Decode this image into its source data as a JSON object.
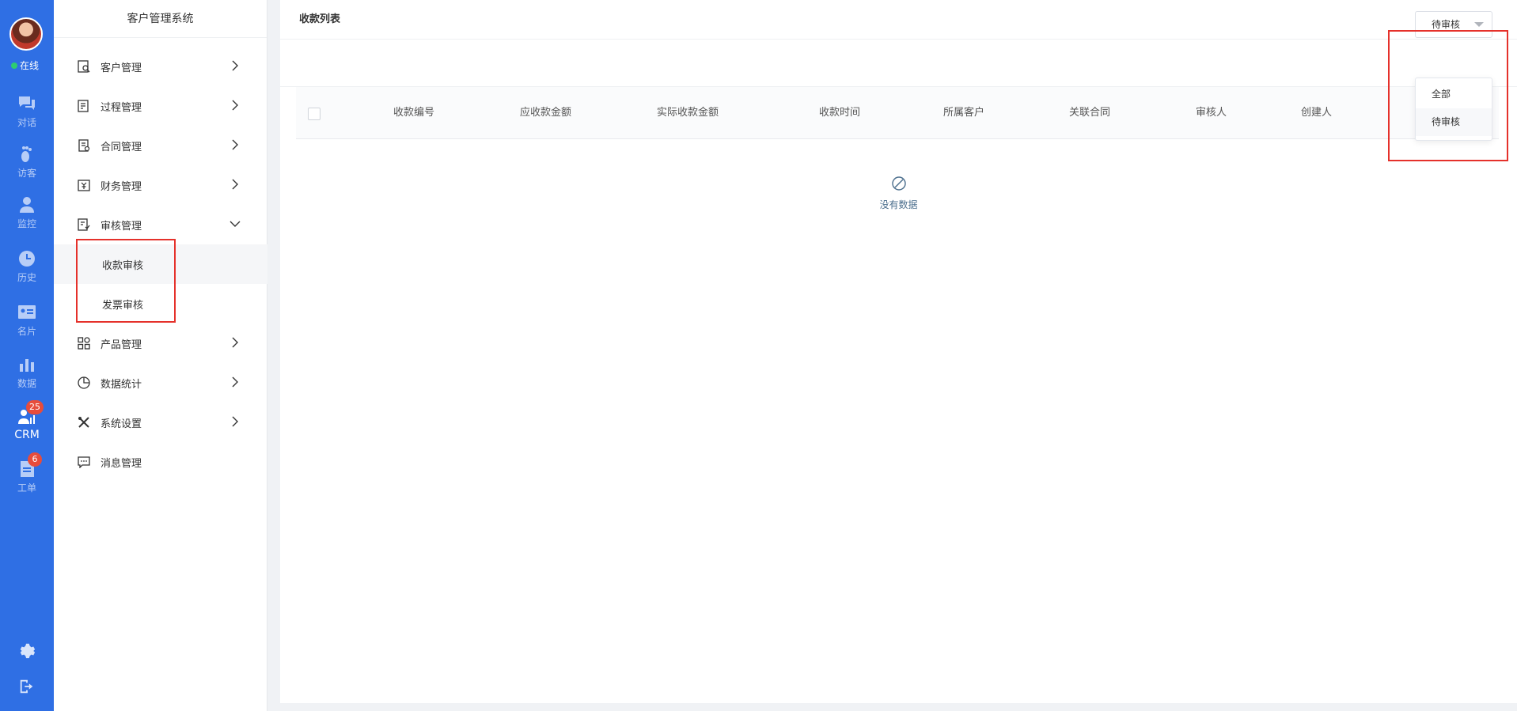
{
  "rail": {
    "status": "在线",
    "items": [
      {
        "label": "对话",
        "icon": "chat-icon"
      },
      {
        "label": "访客",
        "icon": "footprint-icon"
      },
      {
        "label": "监控",
        "icon": "monitor-icon"
      },
      {
        "label": "历史",
        "icon": "clock-icon"
      },
      {
        "label": "名片",
        "icon": "card-icon"
      },
      {
        "label": "数据",
        "icon": "bar-chart-icon"
      },
      {
        "label": "CRM",
        "icon": "crm-icon",
        "badge": "25"
      },
      {
        "label": "工单",
        "icon": "ticket-icon",
        "badge": "6"
      }
    ]
  },
  "sidebar": {
    "title": "客户管理系统",
    "items": [
      {
        "label": "客户管理",
        "icon": "customer-icon"
      },
      {
        "label": "过程管理",
        "icon": "process-icon"
      },
      {
        "label": "合同管理",
        "icon": "contract-icon"
      },
      {
        "label": "财务管理",
        "icon": "finance-icon"
      },
      {
        "label": "审核管理",
        "icon": "audit-icon"
      },
      {
        "label": "产品管理",
        "icon": "product-icon"
      },
      {
        "label": "数据统计",
        "icon": "pie-chart-icon"
      },
      {
        "label": "系统设置",
        "icon": "tools-icon"
      },
      {
        "label": "消息管理",
        "icon": "message-icon"
      }
    ],
    "sub_items": [
      {
        "label": "收款审核"
      },
      {
        "label": "发票审核"
      }
    ]
  },
  "main": {
    "title": "收款列表",
    "filter": {
      "selected": "待审核",
      "options": [
        "全部",
        "待审核"
      ]
    },
    "columns": [
      "收款编号",
      "应收款金额",
      "实际收款金额",
      "收款时间",
      "所属客户",
      "关联合同",
      "审核人",
      "创建人"
    ],
    "empty_text": "没有数据"
  },
  "colors": {
    "rail": "#2f6fe4",
    "annotation": "#e5312b",
    "badge": "#e74c3c"
  }
}
